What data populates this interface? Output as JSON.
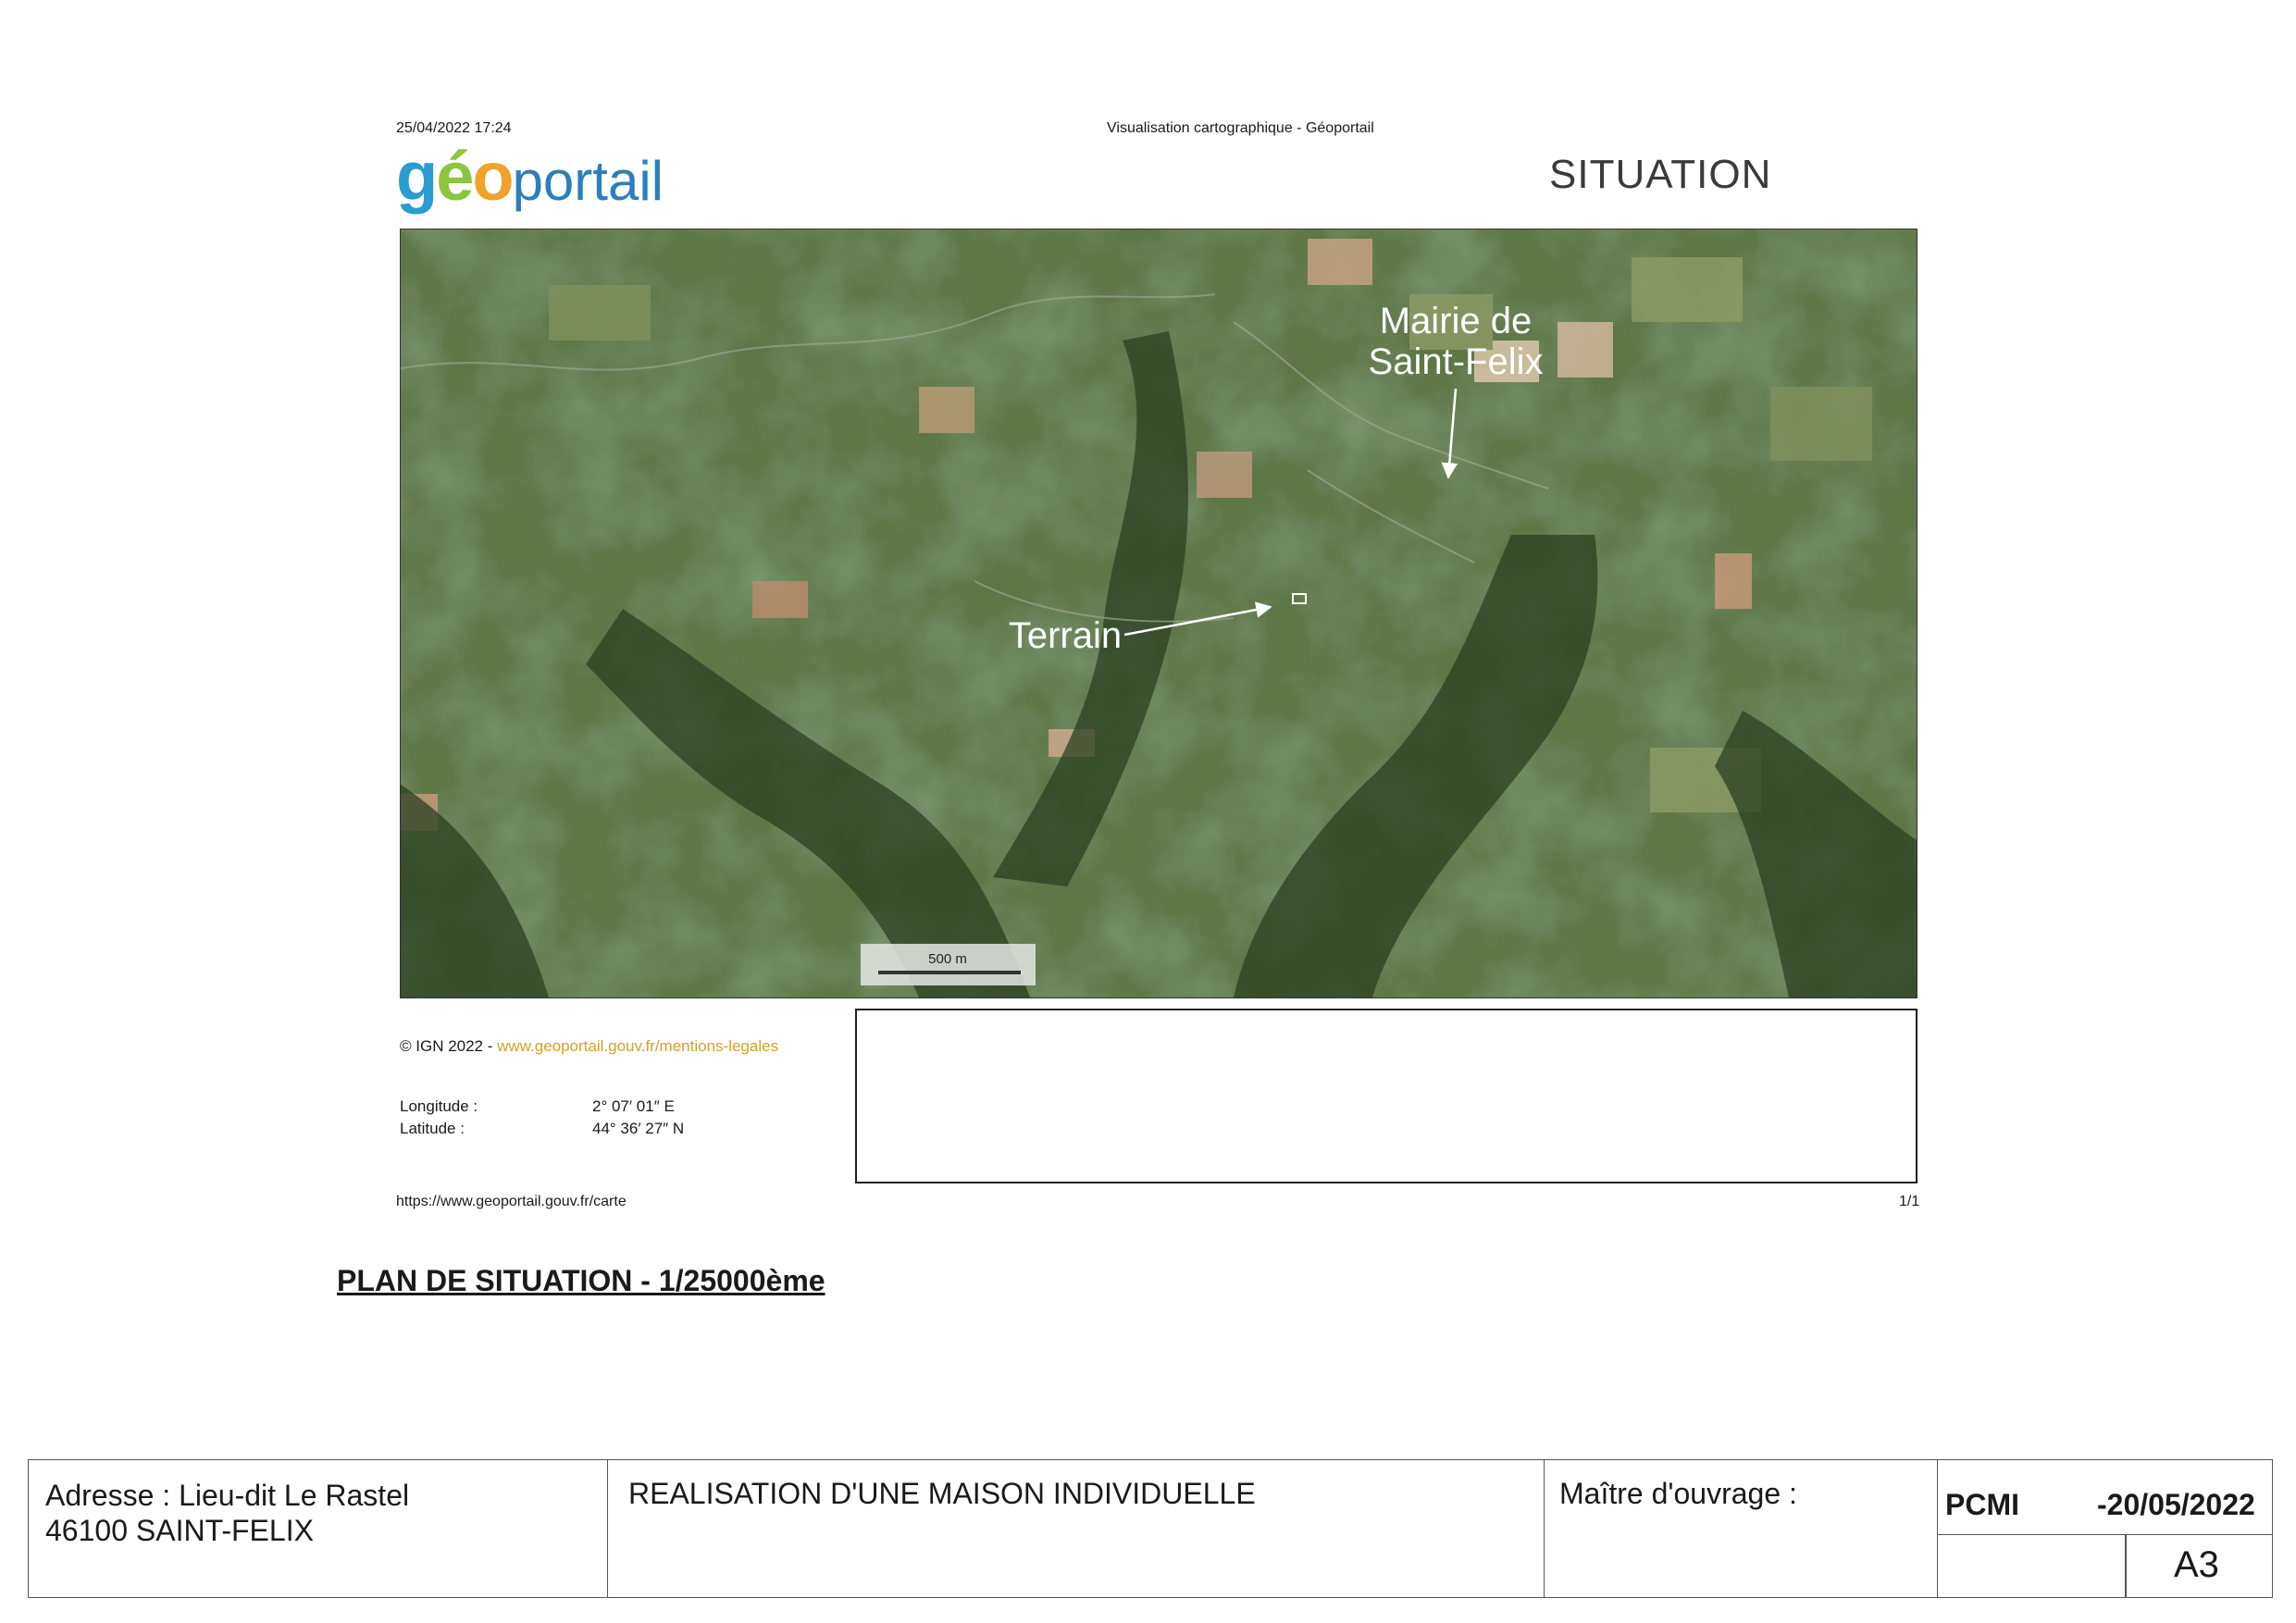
{
  "header": {
    "print_date": "25/04/2022 17:24",
    "print_title": "Visualisation cartographique - Géoportail",
    "logo_geo_g": "g",
    "logo_geo_e": "é",
    "logo_geo_o": "o",
    "logo_portail": "portail",
    "section_title": "SITUATION"
  },
  "map": {
    "label_town_hall_line1": "Mairie de",
    "label_town_hall_line2": "Saint-Felix",
    "label_site": "Terrain",
    "scale_text": "500 m",
    "colors": {
      "forest": "#2f4526",
      "field": "#5f7645",
      "light_field": "#8c9a63",
      "bare_soil": "#c49a78",
      "label": "#ffffff"
    }
  },
  "info": {
    "copyright_prefix": "© IGN 2022 - ",
    "copyright_link": "www.geoportail.gouv.fr/mentions-legales",
    "longitude_label": "Longitude :",
    "longitude_value": "2° 07′ 01″ E",
    "latitude_label": "Latitude :",
    "latitude_value": "44° 36′ 27″ N",
    "page_url": "https://www.geoportail.gouv.fr/carte",
    "page_number": "1/1"
  },
  "plan_title": "PLAN DE SITUATION - 1/25000ème",
  "cartouche": {
    "address_line1": "Adresse : Lieu-dit Le Rastel",
    "address_line2": "46100 SAINT-FELIX",
    "project": "REALISATION D'UNE MAISON INDIVIDUELLE",
    "owner_label": "Maître d'ouvrage :",
    "pcmi_label": "PCMI",
    "pcmi_date": "-20/05/2022",
    "format": "A3"
  }
}
